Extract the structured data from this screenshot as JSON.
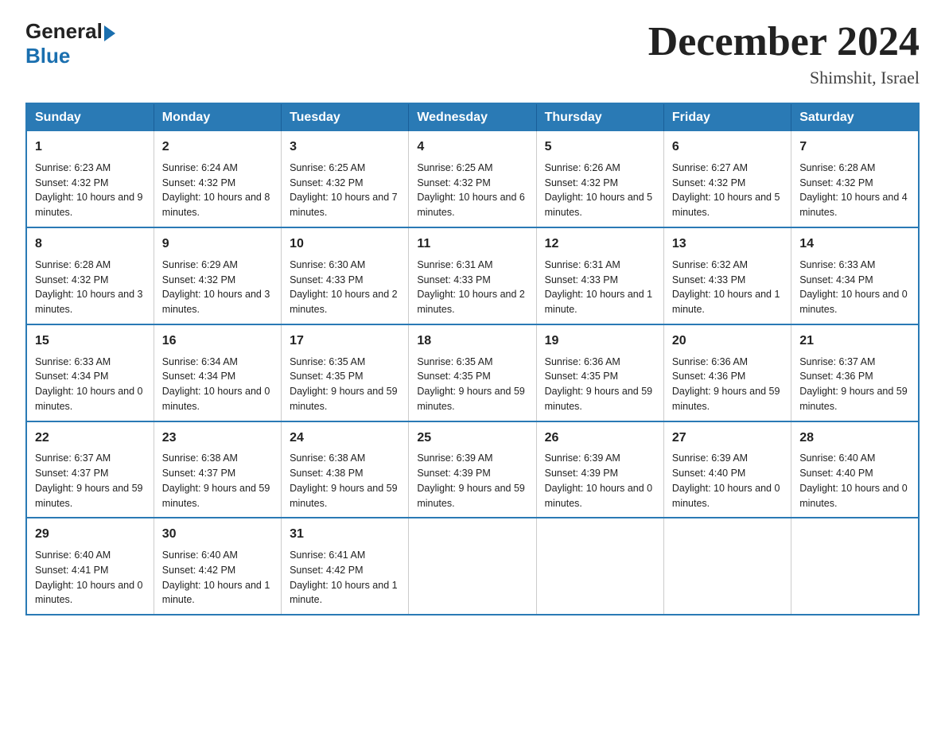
{
  "logo": {
    "general": "General",
    "blue": "Blue"
  },
  "title": {
    "month": "December 2024",
    "location": "Shimshit, Israel"
  },
  "days_of_week": [
    "Sunday",
    "Monday",
    "Tuesday",
    "Wednesday",
    "Thursday",
    "Friday",
    "Saturday"
  ],
  "weeks": [
    [
      {
        "day": "1",
        "sunrise": "6:23 AM",
        "sunset": "4:32 PM",
        "daylight": "10 hours and 9 minutes."
      },
      {
        "day": "2",
        "sunrise": "6:24 AM",
        "sunset": "4:32 PM",
        "daylight": "10 hours and 8 minutes."
      },
      {
        "day": "3",
        "sunrise": "6:25 AM",
        "sunset": "4:32 PM",
        "daylight": "10 hours and 7 minutes."
      },
      {
        "day": "4",
        "sunrise": "6:25 AM",
        "sunset": "4:32 PM",
        "daylight": "10 hours and 6 minutes."
      },
      {
        "day": "5",
        "sunrise": "6:26 AM",
        "sunset": "4:32 PM",
        "daylight": "10 hours and 5 minutes."
      },
      {
        "day": "6",
        "sunrise": "6:27 AM",
        "sunset": "4:32 PM",
        "daylight": "10 hours and 5 minutes."
      },
      {
        "day": "7",
        "sunrise": "6:28 AM",
        "sunset": "4:32 PM",
        "daylight": "10 hours and 4 minutes."
      }
    ],
    [
      {
        "day": "8",
        "sunrise": "6:28 AM",
        "sunset": "4:32 PM",
        "daylight": "10 hours and 3 minutes."
      },
      {
        "day": "9",
        "sunrise": "6:29 AM",
        "sunset": "4:32 PM",
        "daylight": "10 hours and 3 minutes."
      },
      {
        "day": "10",
        "sunrise": "6:30 AM",
        "sunset": "4:33 PM",
        "daylight": "10 hours and 2 minutes."
      },
      {
        "day": "11",
        "sunrise": "6:31 AM",
        "sunset": "4:33 PM",
        "daylight": "10 hours and 2 minutes."
      },
      {
        "day": "12",
        "sunrise": "6:31 AM",
        "sunset": "4:33 PM",
        "daylight": "10 hours and 1 minute."
      },
      {
        "day": "13",
        "sunrise": "6:32 AM",
        "sunset": "4:33 PM",
        "daylight": "10 hours and 1 minute."
      },
      {
        "day": "14",
        "sunrise": "6:33 AM",
        "sunset": "4:34 PM",
        "daylight": "10 hours and 0 minutes."
      }
    ],
    [
      {
        "day": "15",
        "sunrise": "6:33 AM",
        "sunset": "4:34 PM",
        "daylight": "10 hours and 0 minutes."
      },
      {
        "day": "16",
        "sunrise": "6:34 AM",
        "sunset": "4:34 PM",
        "daylight": "10 hours and 0 minutes."
      },
      {
        "day": "17",
        "sunrise": "6:35 AM",
        "sunset": "4:35 PM",
        "daylight": "9 hours and 59 minutes."
      },
      {
        "day": "18",
        "sunrise": "6:35 AM",
        "sunset": "4:35 PM",
        "daylight": "9 hours and 59 minutes."
      },
      {
        "day": "19",
        "sunrise": "6:36 AM",
        "sunset": "4:35 PM",
        "daylight": "9 hours and 59 minutes."
      },
      {
        "day": "20",
        "sunrise": "6:36 AM",
        "sunset": "4:36 PM",
        "daylight": "9 hours and 59 minutes."
      },
      {
        "day": "21",
        "sunrise": "6:37 AM",
        "sunset": "4:36 PM",
        "daylight": "9 hours and 59 minutes."
      }
    ],
    [
      {
        "day": "22",
        "sunrise": "6:37 AM",
        "sunset": "4:37 PM",
        "daylight": "9 hours and 59 minutes."
      },
      {
        "day": "23",
        "sunrise": "6:38 AM",
        "sunset": "4:37 PM",
        "daylight": "9 hours and 59 minutes."
      },
      {
        "day": "24",
        "sunrise": "6:38 AM",
        "sunset": "4:38 PM",
        "daylight": "9 hours and 59 minutes."
      },
      {
        "day": "25",
        "sunrise": "6:39 AM",
        "sunset": "4:39 PM",
        "daylight": "9 hours and 59 minutes."
      },
      {
        "day": "26",
        "sunrise": "6:39 AM",
        "sunset": "4:39 PM",
        "daylight": "10 hours and 0 minutes."
      },
      {
        "day": "27",
        "sunrise": "6:39 AM",
        "sunset": "4:40 PM",
        "daylight": "10 hours and 0 minutes."
      },
      {
        "day": "28",
        "sunrise": "6:40 AM",
        "sunset": "4:40 PM",
        "daylight": "10 hours and 0 minutes."
      }
    ],
    [
      {
        "day": "29",
        "sunrise": "6:40 AM",
        "sunset": "4:41 PM",
        "daylight": "10 hours and 0 minutes."
      },
      {
        "day": "30",
        "sunrise": "6:40 AM",
        "sunset": "4:42 PM",
        "daylight": "10 hours and 1 minute."
      },
      {
        "day": "31",
        "sunrise": "6:41 AM",
        "sunset": "4:42 PM",
        "daylight": "10 hours and 1 minute."
      },
      null,
      null,
      null,
      null
    ]
  ],
  "labels": {
    "sunrise": "Sunrise:",
    "sunset": "Sunset:",
    "daylight": "Daylight:"
  }
}
